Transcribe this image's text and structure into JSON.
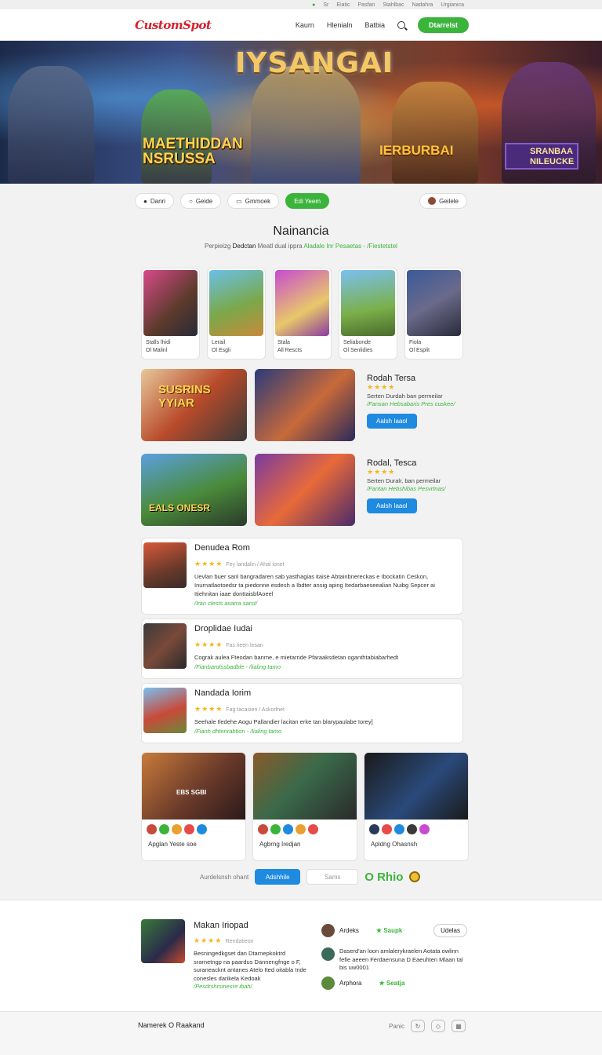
{
  "topstrip": [
    "Sr",
    "Eiatic",
    "Pasfan",
    "Stahlbac",
    "Nadahra",
    "Urgianica"
  ],
  "header": {
    "logo": "CustomSpot",
    "nav": [
      "Kaurn",
      "Hlenialn",
      "Batbia"
    ],
    "cta": "Dtarrelst"
  },
  "hero": {
    "title": "IYSANGAI",
    "left_line1": "MAETHIDDAN",
    "left_line2": "NSRUSSA",
    "mid": "IERBURBAI",
    "badge_line1": "SRANBAA",
    "badge_line2": "NILEUCKE"
  },
  "filters": {
    "chips": [
      "Danri",
      "Geide",
      "Gmmoek"
    ],
    "active": "Edi Yeem",
    "right": "Geilele"
  },
  "section": {
    "title": "Nainancia",
    "sub_prefix": "Perpieizg",
    "sub_mid": "Dedctan",
    "sub_rest": "Meatl dual ippra",
    "sub_green": "Aladale Inr Pesaetas - /Fiestetstel"
  },
  "grid_cards": [
    {
      "l1": "Stalls lhidi",
      "l2": "Ol Malinl"
    },
    {
      "l1": "Lerail",
      "l2": "Ol Esgli"
    },
    {
      "l1": "Stala",
      "l2": "All Rescts"
    },
    {
      "l1": "Seliabonde",
      "l2": "Ol Senlidies"
    },
    {
      "l1": "Fiola",
      "l2": "Ol Esplit"
    }
  ],
  "rows": [
    {
      "img_text": "SUSRINS YYIAR",
      "title": "Rodah Tersa",
      "stars": "★★★★",
      "desc": "Serten Durdah ban permeilar",
      "green": "/Fansan Hebsabaris Pres cuskee/",
      "btn": "Aalsh Iaaol"
    },
    {
      "img_text": "EALS ONESR",
      "title": "Rodal, Tesca",
      "stars": "★★★★",
      "desc": "Serten Duralr, ban permeilar",
      "green": "/Fantan Hebshibas Pesvrtnas/",
      "btn": "Aalsh Iaaol"
    }
  ],
  "reviews": [
    {
      "name": "Denudea Rom",
      "stars": "★★★★",
      "meta": "Fey landalin  /  Ahal ionet",
      "text": "Uevlan buer sanl bangradaren sab yasthagias itaise Abtainbnereckas e Ibockatin Ceskon, Inurnatlaotoedsr ta piedonne esdesh a Ibdter ansig aping Itedarbaeseealian Nuibg Sepcer ai Itiehnitan iaae donttaisbfAoeel",
      "green": "/Iran clests asarra sarst/"
    },
    {
      "name": "Droplidae Iudai",
      "stars": "★★★★",
      "meta": "Fas Iieen lesan",
      "text": "Cograk aulea Fteodan banme, e mietarnde Pfaraaksdetan oganthtabiabarhedt",
      "green": "/Fianbarolssbadble   -   /lialing tamo"
    },
    {
      "name": "Nandada Iorim",
      "stars": "★★★★",
      "meta": "Fag tacasien  /  Askorlnet",
      "text": "Seehale Iledehe Aogu Pallandier lacitan erke tan blarypaulabe Iorey]",
      "green": "/Fianh dhtenrabtion   -   /lialing tamo"
    }
  ],
  "videos": [
    {
      "overlay": "EBS SGBI",
      "label": "Apglan Yeste soe"
    },
    {
      "overlay": "",
      "label": "Agbrng Iredjan"
    },
    {
      "overlay": "",
      "label": "Apldng Ohasnsh"
    }
  ],
  "pager": {
    "text": "Aurdelsnsh ohant",
    "primary": "Adshhile",
    "secondary": "Sams",
    "big": "O Rhio"
  },
  "featured": {
    "name": "Makan Iriopad",
    "stars": "★★★★",
    "meta": "Rendatieon",
    "text": "Besningedkgset dan Dtarnepkoktrd srarnetngp na paardus Dannengfnge o F, suraneacknt antanes Atelo Ited oitabla Inde conesles darikela Kedoak",
    "green": "/Pesdrshrsinesre ibah/"
  },
  "side": [
    {
      "name": "Ardeks",
      "green": "★ Saupk",
      "pill": "Udelas"
    },
    {
      "text": "Daserd'an loon amlalerykraelen Aotata owlinn fefie aeeen Ferdaensuna D Eaeuhten Mlaan tal bis uw0001"
    },
    {
      "name": "Arphora",
      "green": "★ Seatja"
    }
  ],
  "footer": {
    "left": "Namerek   O Raakand",
    "right": "Panic"
  },
  "colors": {
    "green": "#3bb43b",
    "blue": "#1e8ae0",
    "logo": "#d3222e",
    "star": "#f5b518"
  }
}
